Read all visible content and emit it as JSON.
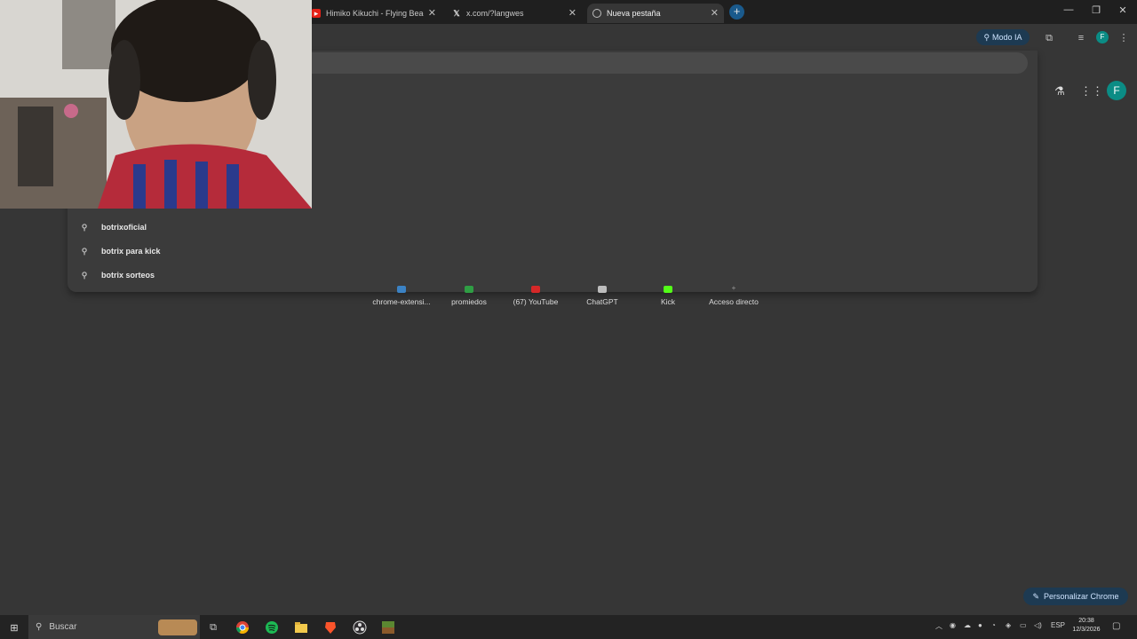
{
  "browser": {
    "tabs": [
      {
        "title": "Himiko Kikuchi - Flying Beagle",
        "favicon": "youtube-icon",
        "active": false
      },
      {
        "title": "x.com/?langwes",
        "favicon": "x-icon",
        "active": false
      },
      {
        "title": "Nueva pestaña",
        "favicon": "chrome-icon",
        "active": true
      }
    ],
    "new_tab_symbol": "+",
    "window_controls": {
      "minimize": "—",
      "restore": "❐",
      "close": "✕"
    },
    "close_symbol": "✕"
  },
  "toolbar": {
    "ai_mode_label": "Modo IA",
    "avatar_letter": "F"
  },
  "omnibox": {
    "suggestions": [
      {
        "text": "botrixoficial"
      },
      {
        "text": "botrix para kick"
      },
      {
        "text": "botrix sorteos"
      }
    ]
  },
  "ntp": {
    "avatar_letter": "F",
    "shortcuts": [
      {
        "label": "chrome-extensi...",
        "color": "#3b82c4"
      },
      {
        "label": "promiedos",
        "color": "#2f9e44"
      },
      {
        "label": "(67) YouTube",
        "color": "#d62828"
      },
      {
        "label": "ChatGPT",
        "color": "#bdbdbd"
      },
      {
        "label": "Kick",
        "color": "#53fc18"
      },
      {
        "label": "Acceso directo",
        "color": "#9a9a9a"
      }
    ],
    "customize_label": "Personalizar Chrome"
  },
  "taskbar": {
    "search_placeholder": "Buscar",
    "language": "ESP",
    "time": "20:38",
    "date": "12/3/2026"
  },
  "colors": {
    "accent": "#1d3a52",
    "background": "#363636",
    "avatar": "#0b8c85"
  }
}
